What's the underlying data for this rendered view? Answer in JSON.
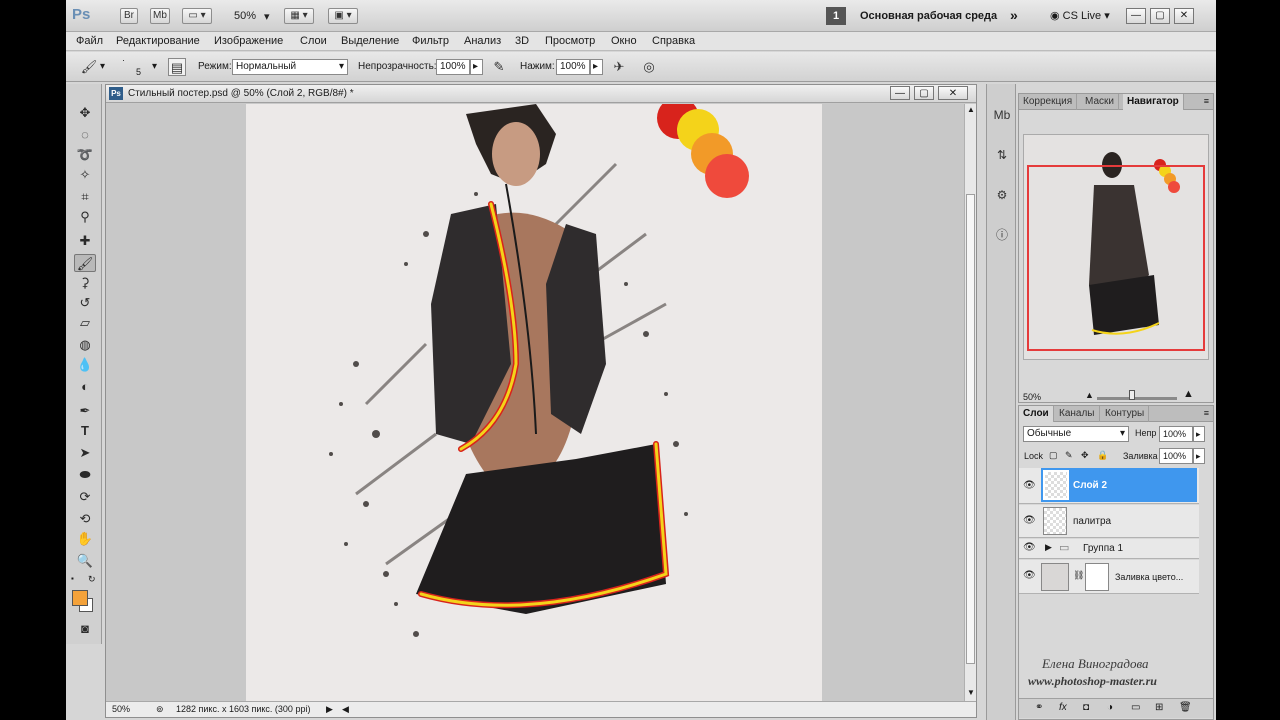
{
  "app": {
    "logo": "Ps",
    "bridge": "Br",
    "minibridge": "Mb",
    "zoom": "50%",
    "workspace_number": "1",
    "workspace_name": "Основная рабочая среда",
    "cs_live": "CS Live"
  },
  "menu": [
    "Файл",
    "Редактирование",
    "Изображение",
    "Слои",
    "Выделение",
    "Фильтр",
    "Анализ",
    "3D",
    "Просмотр",
    "Окно",
    "Справка"
  ],
  "options": {
    "brush_size": "5",
    "mode_label": "Режим:",
    "mode_value": "Нормальный",
    "opacity_label": "Непрозрачность:",
    "opacity_value": "100%",
    "pressure_label": "Нажим:",
    "pressure_value": "100%"
  },
  "document": {
    "title": "Стильный постер.psd @ 50% (Слой 2, RGB/8#) *",
    "status_zoom": "50%",
    "status_info": "1282 пикс. x 1603 пикс. (300 ppi)"
  },
  "navigator": {
    "tabs": [
      "Коррекция",
      "Маски",
      "Навигатор"
    ],
    "zoom": "50%"
  },
  "layers": {
    "tabs": [
      "Слои",
      "Каналы",
      "Контуры"
    ],
    "blend_mode": "Обычные",
    "opacity_label": "Непр",
    "opacity_value": "100%",
    "lock_label": "Lock",
    "fill_label": "Заливка",
    "fill_value": "100%",
    "items": [
      {
        "name": "Слой 2"
      },
      {
        "name": "палитра"
      },
      {
        "name": "Группа 1"
      },
      {
        "name": "Заливка цвето..."
      }
    ]
  },
  "watermark": {
    "author": "Елена Виноградова",
    "site": "www.photoshop-master.ru"
  },
  "colors": {
    "foreground": "#f4a23a",
    "selection": "#3f97ee",
    "nav_frame": "#e53b3b"
  }
}
